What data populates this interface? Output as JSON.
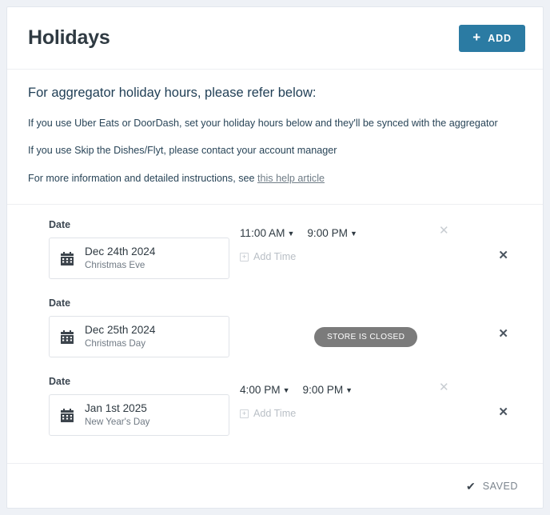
{
  "header": {
    "title": "Holidays",
    "add_button": {
      "label": "ADD",
      "icon": "plus-icon",
      "color": "#2b7ba3"
    }
  },
  "info": {
    "heading": "For aggregator holiday hours, please refer below:",
    "line1": "If you use Uber Eats or DoorDash, set your holiday hours below and they'll be synced with the aggregator",
    "line2": "If you use Skip the Dishes/Flyt, please contact your account manager",
    "line3_prefix": "For more information and detailed instructions, see ",
    "link_text": "this help article"
  },
  "rows": [
    {
      "date_label": "Date",
      "date_main": "Dec 24th 2024",
      "date_sub": "Christmas Eve",
      "open_time": "11:00 AM",
      "close_time": "9:00 PM",
      "add_time_label": "Add Time",
      "closed": false
    },
    {
      "date_label": "Date",
      "date_main": "Dec 25th 2024",
      "date_sub": "Christmas Day",
      "closed": true,
      "closed_badge": "STORE IS CLOSED"
    },
    {
      "date_label": "Date",
      "date_main": "Jan 1st 2025",
      "date_sub": "New Year's Day",
      "open_time": "4:00 PM",
      "close_time": "9:00 PM",
      "add_time_label": "Add Time",
      "closed": false
    }
  ],
  "footer": {
    "saved_label": "SAVED",
    "saved_icon": "check-icon"
  },
  "colors": {
    "accent": "#2b7ba3",
    "page_background": "#eef1f6",
    "badge_gray": "#7b7b7b",
    "heading_navy": "#1f3e55"
  }
}
